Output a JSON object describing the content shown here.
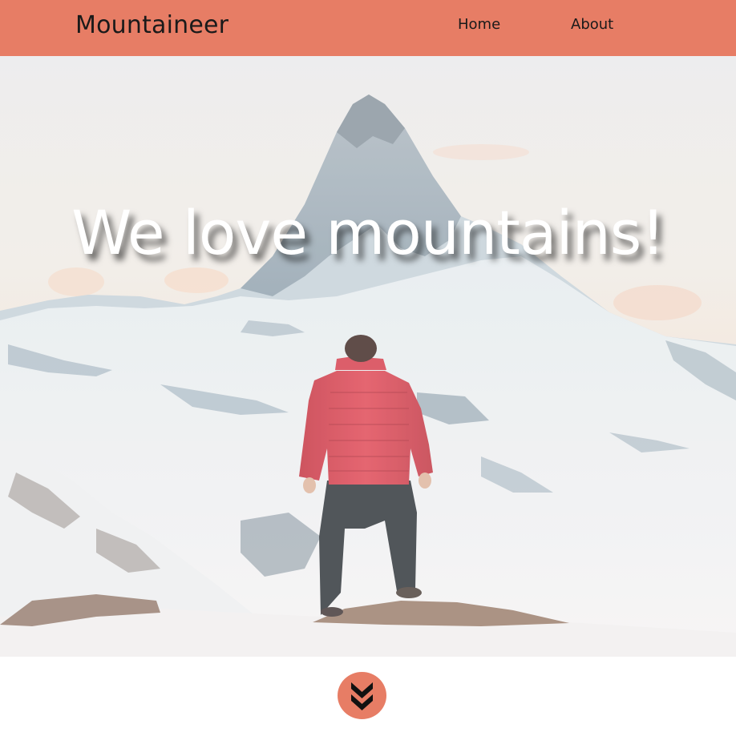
{
  "navbar": {
    "brand": "Mountaineer",
    "links": [
      {
        "label": "Home"
      },
      {
        "label": "About"
      }
    ],
    "background": "#e77d65"
  },
  "hero": {
    "title": "We love mountains!",
    "image": "photo of a hiker in a red jacket facing a snowy mountain peak"
  },
  "scroll_button": {
    "icon": "double-chevron-down-icon",
    "color": "#e77d65"
  }
}
